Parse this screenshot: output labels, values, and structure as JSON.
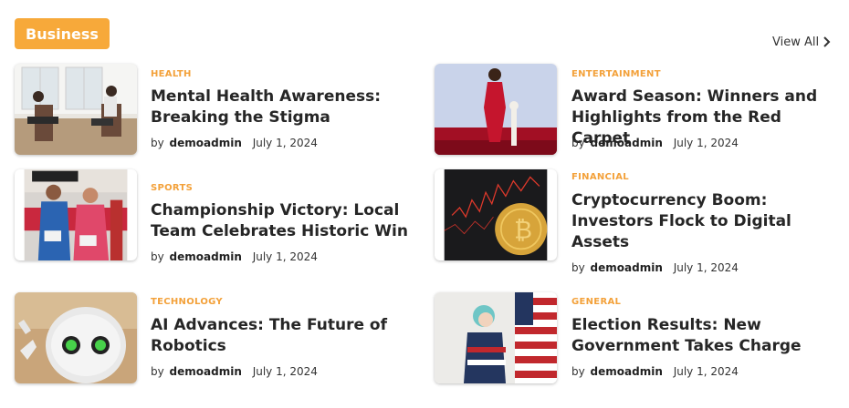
{
  "section": {
    "label": "Business",
    "view_all": "View All"
  },
  "colors": {
    "accent": "#f7a93a",
    "title": "#262626"
  },
  "articles": [
    {
      "category": "HEALTH",
      "title": "Mental Health Awareness: Breaking the Stigma",
      "by": "by",
      "author": "demoadmin",
      "date": "July 1, 2024"
    },
    {
      "category": "ENTERTAINMENT",
      "title": "Award Season: Winners and Highlights from the Red Carpet",
      "by": "by",
      "author": "demoadmin",
      "date": "July 1, 2024"
    },
    {
      "category": "SPORTS",
      "title": "Championship Victory: Local Team Celebrates Historic Win",
      "by": "by",
      "author": "demoadmin",
      "date": "July 1, 2024"
    },
    {
      "category": "FINANCIAL",
      "title": "Cryptocurrency Boom: Investors Flock to Digital Assets",
      "by": "by",
      "author": "demoadmin",
      "date": "July 1, 2024"
    },
    {
      "category": "TECHNOLOGY",
      "title": "AI Advances: The Future of Robotics",
      "by": "by",
      "author": "demoadmin",
      "date": "July 1, 2024"
    },
    {
      "category": "GENERAL",
      "title": "Election Results: New Government Takes Charge",
      "by": "by",
      "author": "demoadmin",
      "date": "July 1, 2024"
    }
  ]
}
